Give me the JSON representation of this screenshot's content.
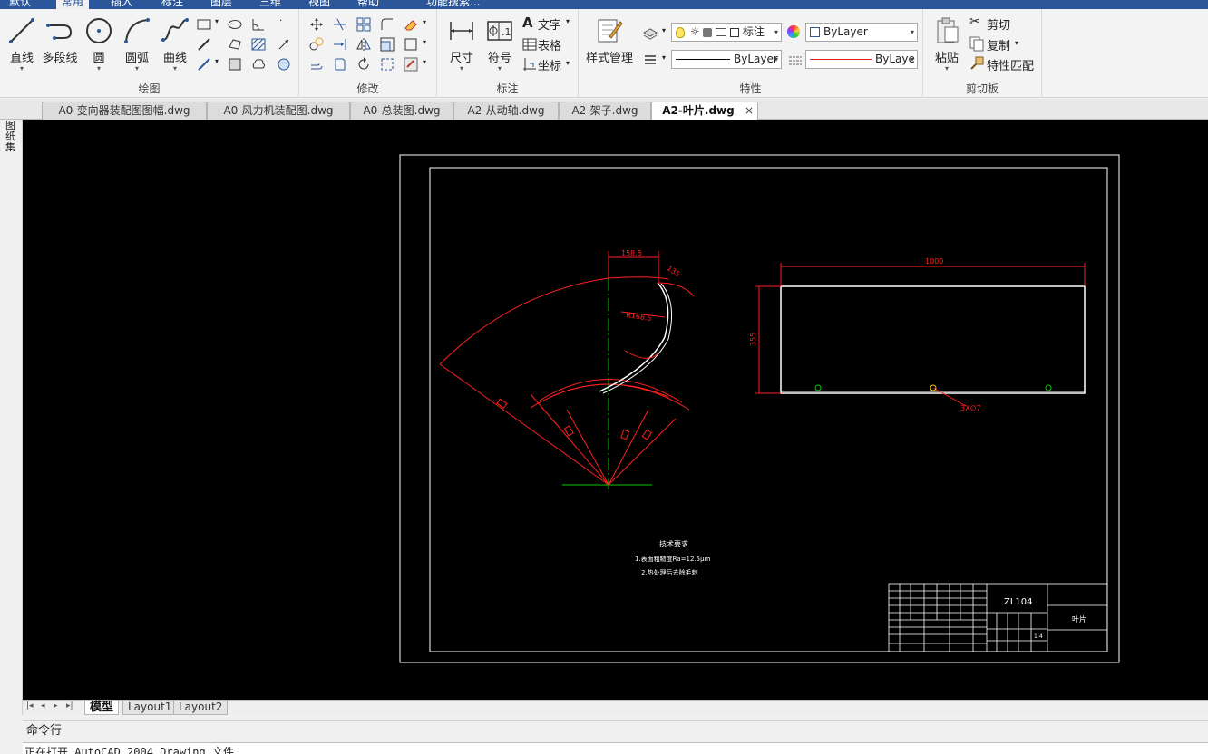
{
  "menu": {
    "tabs": [
      "默认",
      "常用",
      "插入",
      "标注",
      "图层",
      "三维",
      "视图",
      "帮助",
      "功能搜索..."
    ],
    "active": "常用"
  },
  "ribbon": {
    "draw": {
      "title": "绘图",
      "line": "直线",
      "polyline": "多段线",
      "circle": "圆",
      "arc": "圆弧",
      "spline": "曲线"
    },
    "modify": {
      "title": "修改"
    },
    "annotate": {
      "title": "标注",
      "dimension": "尺寸",
      "symbol": "符号",
      "text": "文字",
      "table": "表格",
      "coord": "坐标"
    },
    "properties": {
      "title": "特性",
      "style_manager": "样式管理",
      "layer_state": "标注",
      "color": "ByLayer",
      "linetype": "ByLayer",
      "lineweight": "ByLaye"
    },
    "clipboard": {
      "title": "剪切板",
      "paste": "粘贴",
      "cut": "剪切",
      "copy": "复制",
      "match": "特性匹配"
    }
  },
  "file_tabs": [
    {
      "label": "A0-变向器装配图图幅.dwg"
    },
    {
      "label": "A0-风力机装配图.dwg"
    },
    {
      "label": "A0-总装图.dwg"
    },
    {
      "label": "A2-从动轴.dwg"
    },
    {
      "label": "A2-架子.dwg"
    },
    {
      "label": "A2-叶片.dwg",
      "active": true
    }
  ],
  "file_tab_close": "×",
  "side_strip": {
    "label": "图纸集"
  },
  "drawing": {
    "dims": {
      "d1": "158.5",
      "d2": "R168.5",
      "d3": "135",
      "width": "1000",
      "height": "355",
      "holes": "3X∅7"
    },
    "notes": {
      "title": "技术要求",
      "line1": "1.表面粗糙度Ra=12.5μm",
      "line2": "2.热处理后去除毛刺"
    },
    "titleblock": {
      "code": "ZL104",
      "name": "叶片",
      "scale": "1:4"
    }
  },
  "layout_tabs": [
    {
      "label": "模型",
      "active": true
    },
    {
      "label": "Layout1"
    },
    {
      "label": "Layout2"
    }
  ],
  "command": {
    "title": "命令行",
    "text": "正在打开 AutoCAD 2004 Drawing 文件"
  },
  "colors": {
    "menu_blue": "#2b579a",
    "canvas": "#000000",
    "dim_red": "#ff2020",
    "center_green": "#00cc00"
  }
}
